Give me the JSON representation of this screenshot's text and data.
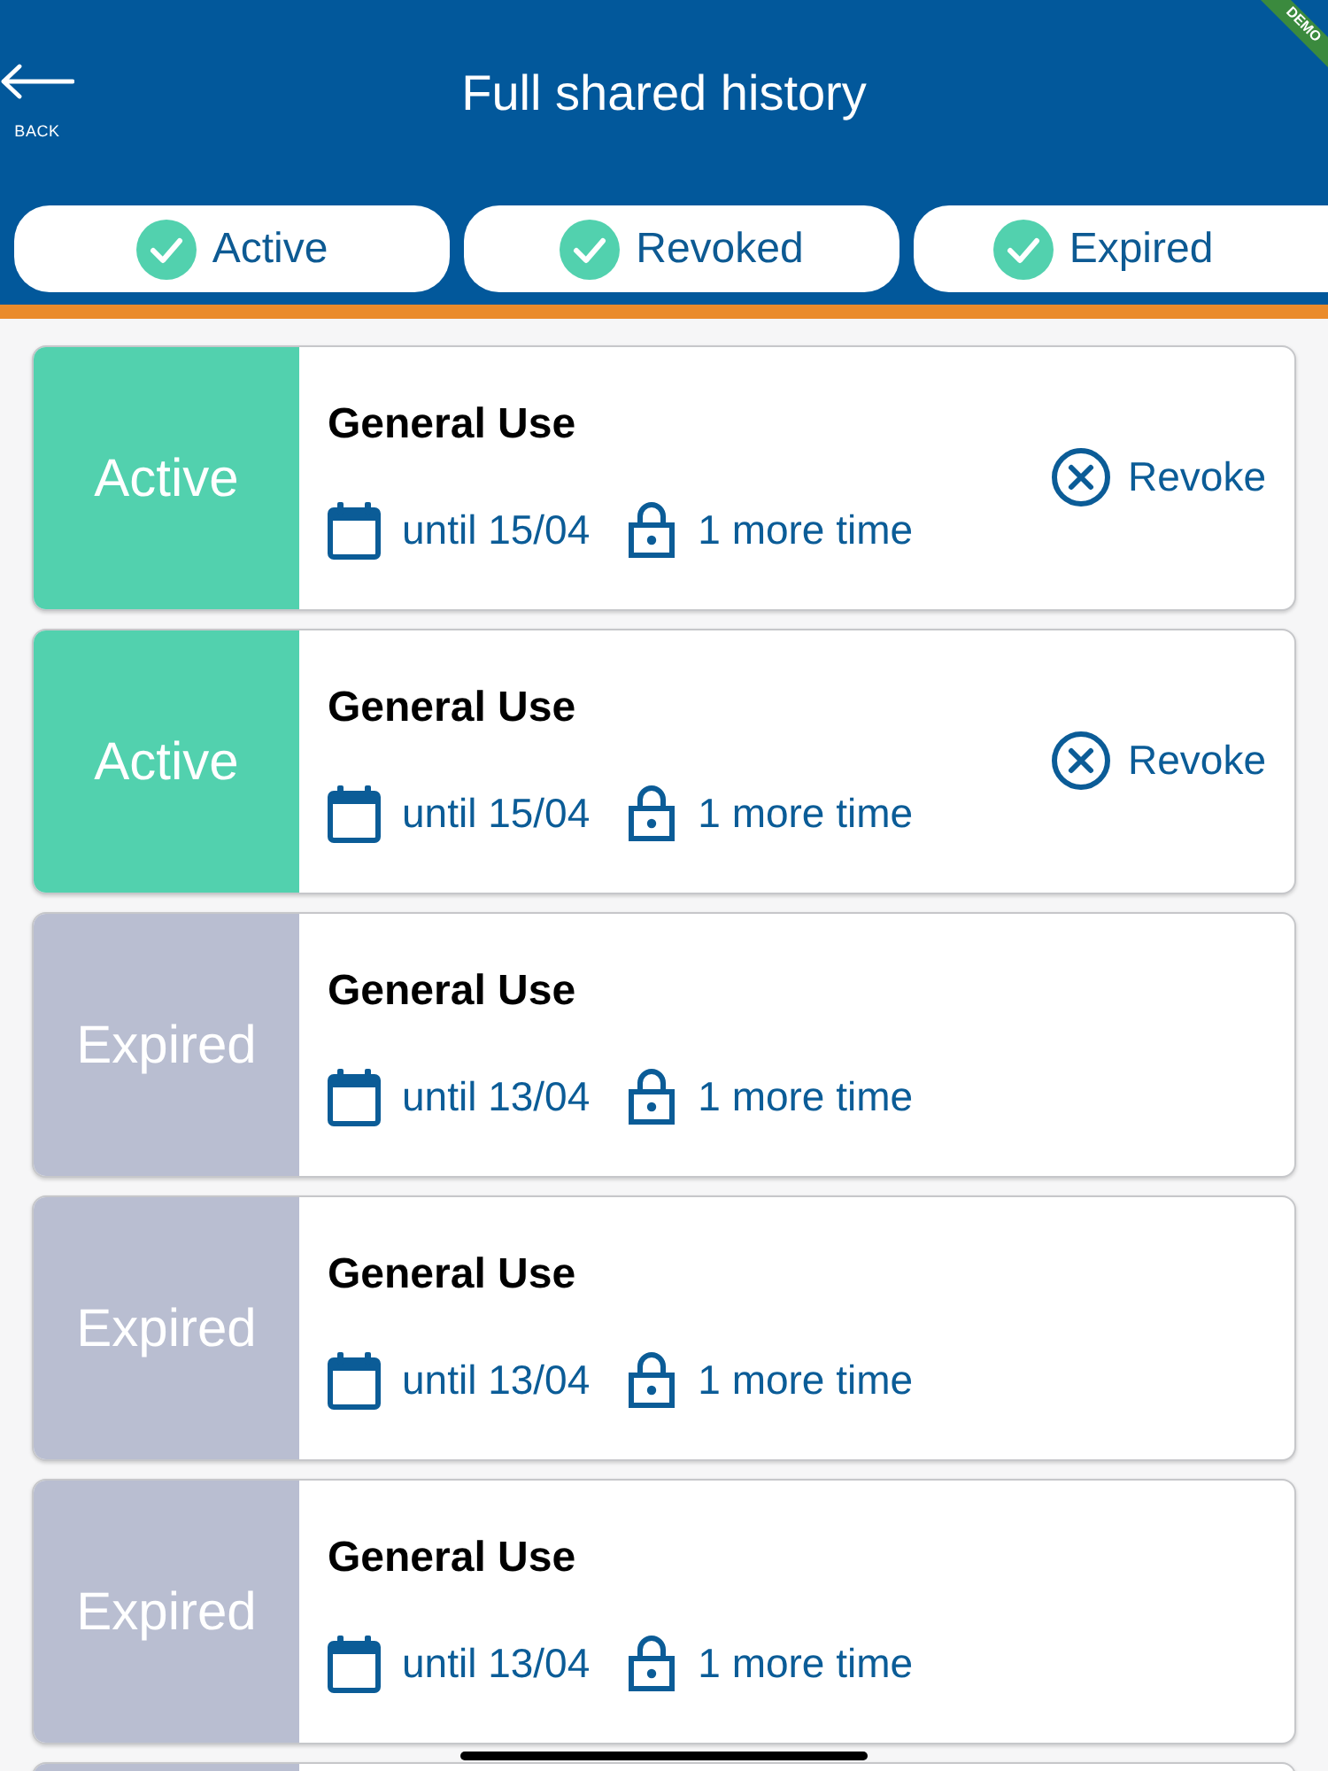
{
  "header": {
    "back_label": "BACK",
    "title": "Full shared history",
    "banner": "DEMO"
  },
  "filters": [
    {
      "label": "Active",
      "checked": true
    },
    {
      "label": "Revoked",
      "checked": true
    },
    {
      "label": "Expired",
      "checked": true
    }
  ],
  "cards": [
    {
      "kind": "active",
      "status": "Active",
      "title": "General Use",
      "until": "until 15/04",
      "uses": "1 more time",
      "action": "Revoke"
    },
    {
      "kind": "active",
      "status": "Active",
      "title": "General Use",
      "until": "until 15/04",
      "uses": "1 more time",
      "action": "Revoke"
    },
    {
      "kind": "expired",
      "status": "Expired",
      "title": "General Use",
      "until": "until 13/04",
      "uses": "1 more time"
    },
    {
      "kind": "expired",
      "status": "Expired",
      "title": "General Use",
      "until": "until 13/04",
      "uses": "1 more time"
    },
    {
      "kind": "expired",
      "status": "Expired",
      "title": "General Use",
      "until": "until 13/04",
      "uses": "1 more time"
    },
    {
      "kind": "expired"
    }
  ]
}
